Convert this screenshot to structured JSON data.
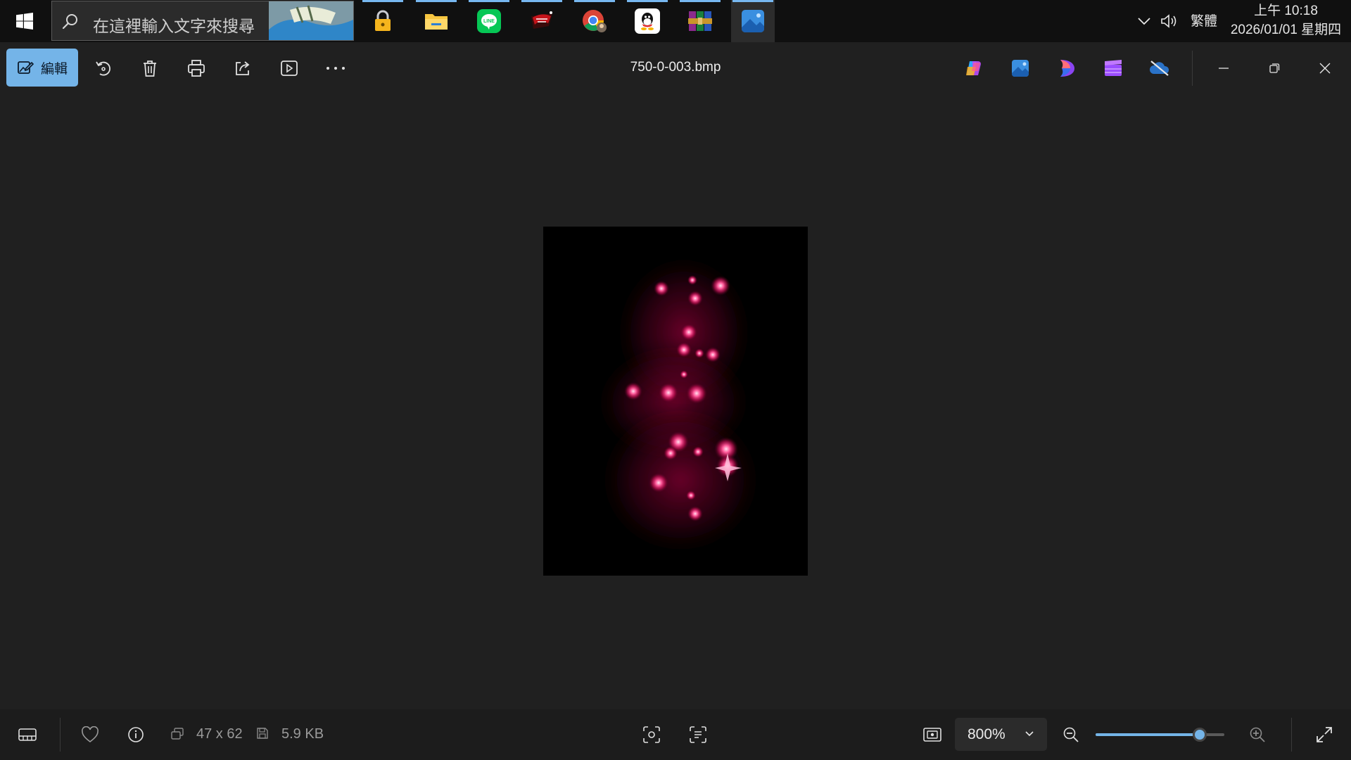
{
  "taskbar": {
    "search_placeholder": "在這裡輸入文字來搜尋",
    "apps": [
      {
        "name": "lock-app-icon",
        "running": true
      },
      {
        "name": "file-explorer-icon",
        "running": true
      },
      {
        "name": "line-app-icon",
        "running": true
      },
      {
        "name": "game-app-icon",
        "running": true
      },
      {
        "name": "chrome-icon",
        "running": true
      },
      {
        "name": "qq-icon",
        "running": true
      },
      {
        "name": "winrar-icon",
        "running": true
      },
      {
        "name": "photos-app-icon",
        "running": true,
        "active": true
      }
    ],
    "ime_label": "繁體",
    "clock_time": "上午 10:18",
    "clock_date": "2026/01/01 星期四"
  },
  "toolbar": {
    "edit_label": "編輯",
    "file_name": "750-0-003.bmp"
  },
  "status": {
    "dimensions": "47 x 62",
    "file_size": "5.9 KB",
    "zoom_level": "800%",
    "zoom_slider_fraction": 0.81
  },
  "colors": {
    "accent": "#74b4e8",
    "glow": "#ff2a7a",
    "background": "#202020"
  }
}
